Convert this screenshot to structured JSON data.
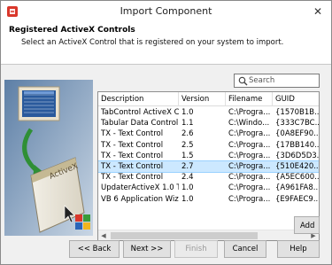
{
  "window": {
    "title": "Import Component",
    "close_glyph": "✕",
    "app_icon": "component-import-icon"
  },
  "header": {
    "title": "Registered ActiveX Controls",
    "subtitle": "Select an ActiveX Control that is registered on your system to import."
  },
  "illustration": {
    "label": "ActiveX"
  },
  "search": {
    "placeholder": "Search",
    "value": ""
  },
  "grid": {
    "columns": [
      "Description",
      "Version",
      "Filename",
      "GUID"
    ],
    "rows": [
      {
        "description": "TabControl ActiveX Co...",
        "version": "1.0",
        "filename": "C:\\Progra...",
        "guid": "{1570B1B..."
      },
      {
        "description": "Tabular Data Control ...",
        "version": "1.1",
        "filename": "C:\\Windo...",
        "guid": "{333C7BC..."
      },
      {
        "description": "TX - Text Control",
        "version": "2.6",
        "filename": "C:\\Progra...",
        "guid": "{0A8EF90..."
      },
      {
        "description": "TX - Text Control",
        "version": "2.5",
        "filename": "C:\\Progra...",
        "guid": "{17BB140..."
      },
      {
        "description": "TX - Text Control",
        "version": "1.5",
        "filename": "C:\\Progra...",
        "guid": "{3D6D5D3..."
      },
      {
        "description": "TX - Text Control",
        "version": "2.7",
        "filename": "C:\\Progra...",
        "guid": "{510E420..."
      },
      {
        "description": "TX - Text Control",
        "version": "2.4",
        "filename": "C:\\Progra...",
        "guid": "{A5EC600..."
      },
      {
        "description": "UpdaterActiveX 1.0 T...",
        "version": "1.0",
        "filename": "C:\\Progra...",
        "guid": "{A961FA8..."
      },
      {
        "description": "VB 6 Application Wizard",
        "version": "1.0",
        "filename": "C:\\Progra...",
        "guid": "{E9FAEC9..."
      }
    ],
    "selected_index": 5
  },
  "buttons": {
    "add": "Add",
    "back": "<< Back",
    "next": "Next >>",
    "finish": "Finish",
    "cancel": "Cancel",
    "help": "Help"
  },
  "colors": {
    "selection": "#cce8ff",
    "selection_border": "#99d1ff",
    "dialog_bg": "#f0f0f0"
  }
}
